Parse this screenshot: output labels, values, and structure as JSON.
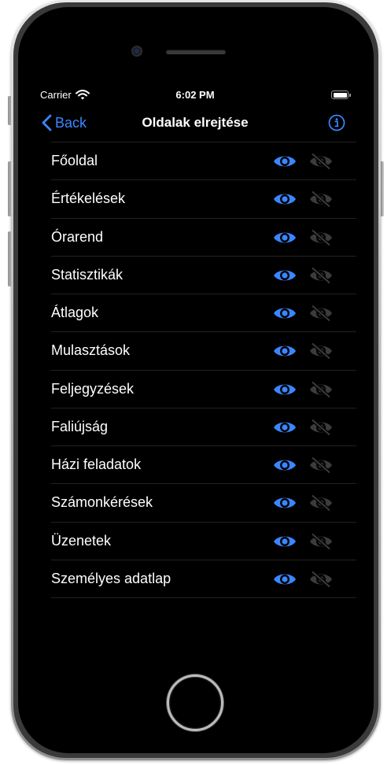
{
  "colors": {
    "accent": "#3a86ff",
    "inactive": "#3b3b3b",
    "background": "#000000"
  },
  "status": {
    "carrier": "Carrier",
    "time": "6:02 PM",
    "wifi_icon": "wifi-icon",
    "battery_icon": "battery-icon",
    "battery_level": 1.0
  },
  "nav": {
    "back_label": "Back",
    "back_icon": "chevron-left-icon",
    "title": "Oldalak elrejtése",
    "info_icon": "info-circle-icon"
  },
  "row_icons": {
    "show": "eye-icon",
    "hide": "eye-slash-icon"
  },
  "rows": [
    {
      "label": "Főoldal"
    },
    {
      "label": "Értékelések"
    },
    {
      "label": "Órarend"
    },
    {
      "label": "Statisztikák"
    },
    {
      "label": "Átlagok"
    },
    {
      "label": "Mulasztások"
    },
    {
      "label": "Feljegyzések"
    },
    {
      "label": "Faliújság"
    },
    {
      "label": "Házi feladatok"
    },
    {
      "label": "Számonkérések"
    },
    {
      "label": "Üzenetek"
    },
    {
      "label": "Személyes adatlap"
    }
  ],
  "device": {
    "home_button": "home-button"
  }
}
